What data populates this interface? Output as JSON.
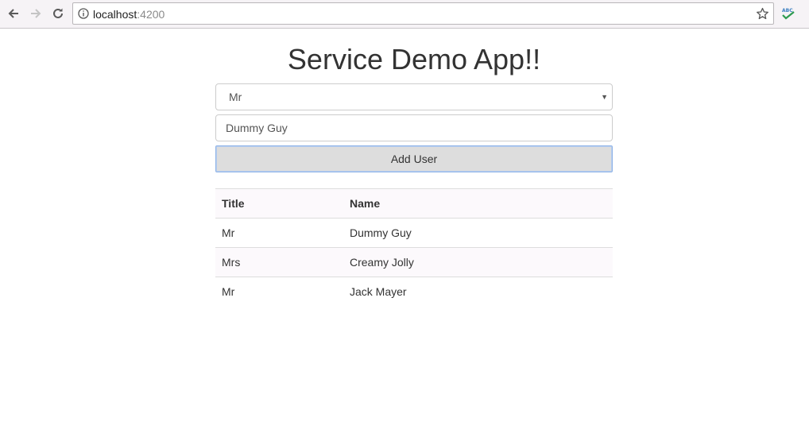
{
  "browser": {
    "url_host": "localhost",
    "url_port": ":4200"
  },
  "page": {
    "title": "Service Demo App!!"
  },
  "form": {
    "title_select_value": "Mr",
    "name_value": "Dummy Guy",
    "add_button_label": "Add User"
  },
  "table": {
    "headers": [
      "Title",
      "Name"
    ],
    "rows": [
      {
        "title": "Mr",
        "name": "Dummy Guy"
      },
      {
        "title": "Mrs",
        "name": "Creamy Jolly"
      },
      {
        "title": "Mr",
        "name": "Jack Mayer"
      }
    ]
  },
  "colors": {
    "button_focus_border": "#8fb3e6",
    "button_bg": "#dddddd",
    "stripe": "#fcf9fc"
  }
}
